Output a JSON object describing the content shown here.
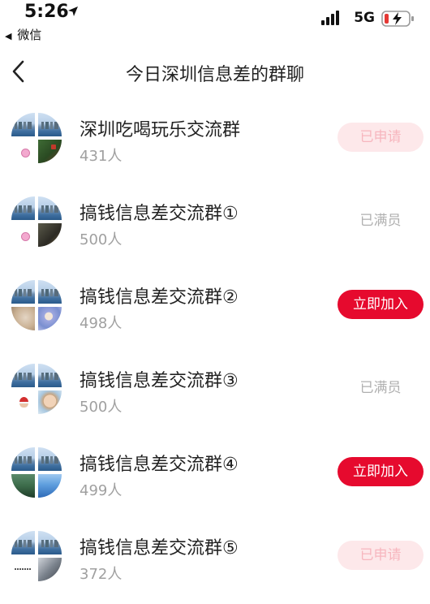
{
  "status_bar": {
    "time": "5:26",
    "back_app": "微信",
    "network": "5G",
    "battery_color": "#e53935"
  },
  "header": {
    "title": "今日深圳信息差的群聊",
    "back_icon": "chevron-left-icon"
  },
  "groups": [
    {
      "name": "深圳吃喝玩乐交流群",
      "count": "431人",
      "action": "已申请",
      "state": "applied"
    },
    {
      "name": "搞钱信息差交流群①",
      "count": "500人",
      "action": "已满员",
      "state": "full"
    },
    {
      "name": "搞钱信息差交流群②",
      "count": "498人",
      "action": "立即加入",
      "state": "join"
    },
    {
      "name": "搞钱信息差交流群③",
      "count": "500人",
      "action": "已满员",
      "state": "full"
    },
    {
      "name": "搞钱信息差交流群④",
      "count": "499人",
      "action": "立即加入",
      "state": "join"
    },
    {
      "name": "搞钱信息差交流群⑤",
      "count": "372人",
      "action": "已申请",
      "state": "applied"
    }
  ],
  "colors": {
    "accent": "#e60a2e",
    "applied_bg": "#fde8ea",
    "applied_text": "#f7b6be",
    "muted_text": "#a0a0a0"
  }
}
